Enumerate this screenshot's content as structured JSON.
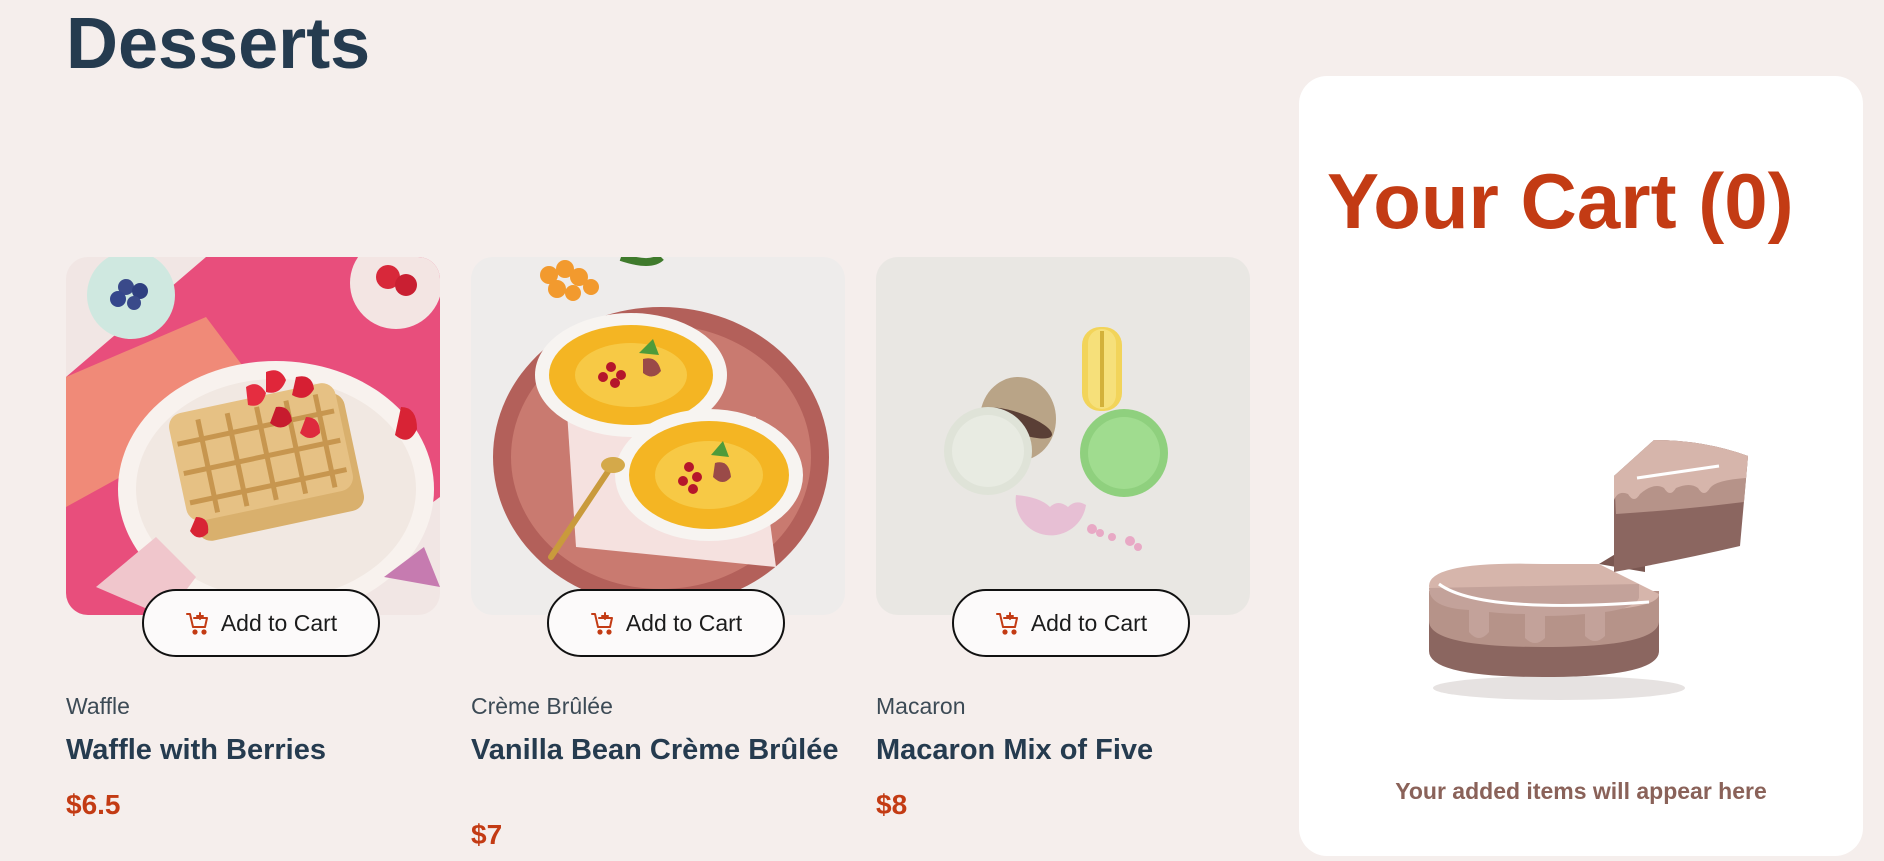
{
  "page": {
    "title": "Desserts"
  },
  "products": [
    {
      "image": "waffle-photo",
      "add_label": "Add to Cart",
      "category": "Waffle",
      "name": "Waffle with Berries",
      "price": "$6.5"
    },
    {
      "image": "creme-brulee-photo",
      "add_label": "Add to Cart",
      "category": "Crème Brûlée",
      "name": "Vanilla Bean Crème Brûlée",
      "price": "$7"
    },
    {
      "image": "macaron-photo",
      "add_label": "Add to Cart",
      "category": "Macaron",
      "name": "Macaron Mix of Five",
      "price": "$8"
    }
  ],
  "cart": {
    "title": "Your Cart (0)",
    "empty_message": "Your added items will appear here",
    "empty_icon": "empty-cake-illustration"
  },
  "colors": {
    "page_background": "#f5eeec",
    "heading": "#253b4f",
    "accent": "#c33b14",
    "muted_brown": "#8a6259"
  }
}
